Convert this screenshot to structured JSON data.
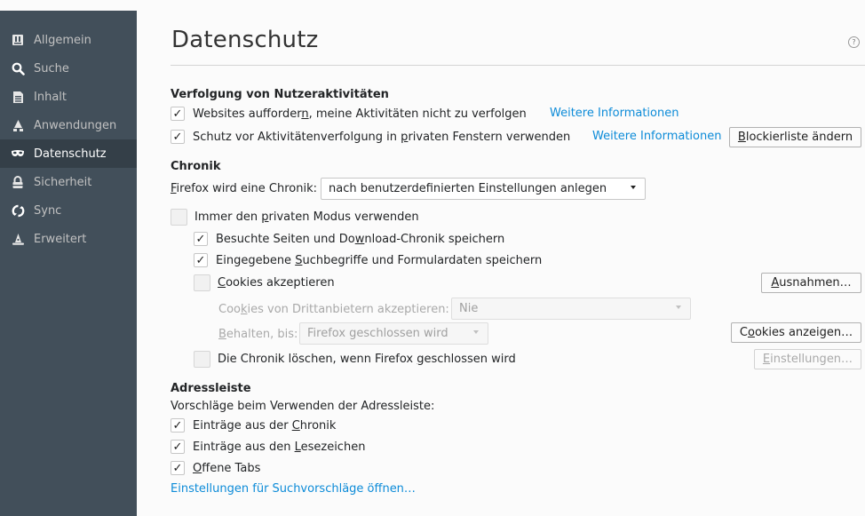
{
  "sidebar": {
    "items": [
      {
        "label": "Allgemein",
        "icon": "general-icon"
      },
      {
        "label": "Suche",
        "icon": "search-icon"
      },
      {
        "label": "Inhalt",
        "icon": "content-icon"
      },
      {
        "label": "Anwendungen",
        "icon": "applications-icon"
      },
      {
        "label": "Datenschutz",
        "icon": "privacy-mask-icon"
      },
      {
        "label": "Sicherheit",
        "icon": "lock-icon"
      },
      {
        "label": "Sync",
        "icon": "sync-icon"
      },
      {
        "label": "Erweitert",
        "icon": "wizard-hat-icon"
      }
    ],
    "selected": "Datenschutz"
  },
  "header": {
    "title": "Datenschutz",
    "help": "?"
  },
  "tracking": {
    "title": "Verfolgung von Nutzeraktivitäten",
    "dnt_pre": "Websites aufforder",
    "dnt_key": "n",
    "dnt_post": ", meine Aktivitäten nicht zu verfolgen",
    "dnt_checked": true,
    "dnt_link": "Weitere Informationen",
    "tp_pre": "Schutz vor Aktivitätenverfolgung in ",
    "tp_key": "p",
    "tp_post": "rivaten Fenstern verwenden",
    "tp_checked": true,
    "tp_link": "Weitere Informationen",
    "blocklist_key": "B",
    "blocklist_rest": "lockierliste ändern"
  },
  "history": {
    "title": "Chronik",
    "mode_key": "F",
    "mode_rest": "irefox wird eine Chronik:",
    "mode_value": "nach benutzerdefinierten Einstellungen anlegen",
    "private_pre": "Immer den ",
    "private_key": "p",
    "private_post": "rivaten Modus verwenden",
    "private_checked": false,
    "visited_pre": "Besuchte Seiten und Do",
    "visited_key": "w",
    "visited_post": "nload-Chronik speichern",
    "visited_checked": true,
    "forms_pre": "Eingegebene ",
    "forms_key": "S",
    "forms_post": "uchbegriffe und Formulardaten speichern",
    "forms_checked": true,
    "cookies_key": "C",
    "cookies_rest": "ookies akzeptieren",
    "cookies_checked": false,
    "exceptions_key": "A",
    "exceptions_rest": "usnahmen…",
    "third_pre": "Coo",
    "third_key": "k",
    "third_post": "ies von Drittanbietern akzeptieren:",
    "third_value": "Nie",
    "keep_key": "B",
    "keep_rest": "ehalten, bis:",
    "keep_value": "Firefox geschlossen wird",
    "show_cookies_pre": "C",
    "show_cookies_key": "o",
    "show_cookies_post": "okies anzeigen…",
    "clear_pre": "Die Chronik löschen, wenn Firefox ",
    "clear_key": "g",
    "clear_post": "eschlossen wird",
    "clear_checked": false,
    "settings_key": "E",
    "settings_rest": "instellungen…"
  },
  "urlbar": {
    "title": "Adressleiste",
    "subtitle": "Vorschläge beim Verwenden der Adressleiste:",
    "history_pre": "Einträge aus der ",
    "history_key": "C",
    "history_post": "hronik",
    "history_checked": true,
    "bookmarks_pre": "Einträge aus den ",
    "bookmarks_key": "L",
    "bookmarks_post": "esezeichen",
    "bookmarks_checked": true,
    "tabs_key": "O",
    "tabs_rest": "ffene Tabs",
    "tabs_checked": true,
    "suggest_link": "Einstellungen für Suchvorschläge öffnen…"
  },
  "colors": {
    "sidebar_bg": "#424f5a",
    "sidebar_selected": "#343f48",
    "link": "#0c8bd8",
    "page_bg": "#fbfbfb"
  }
}
